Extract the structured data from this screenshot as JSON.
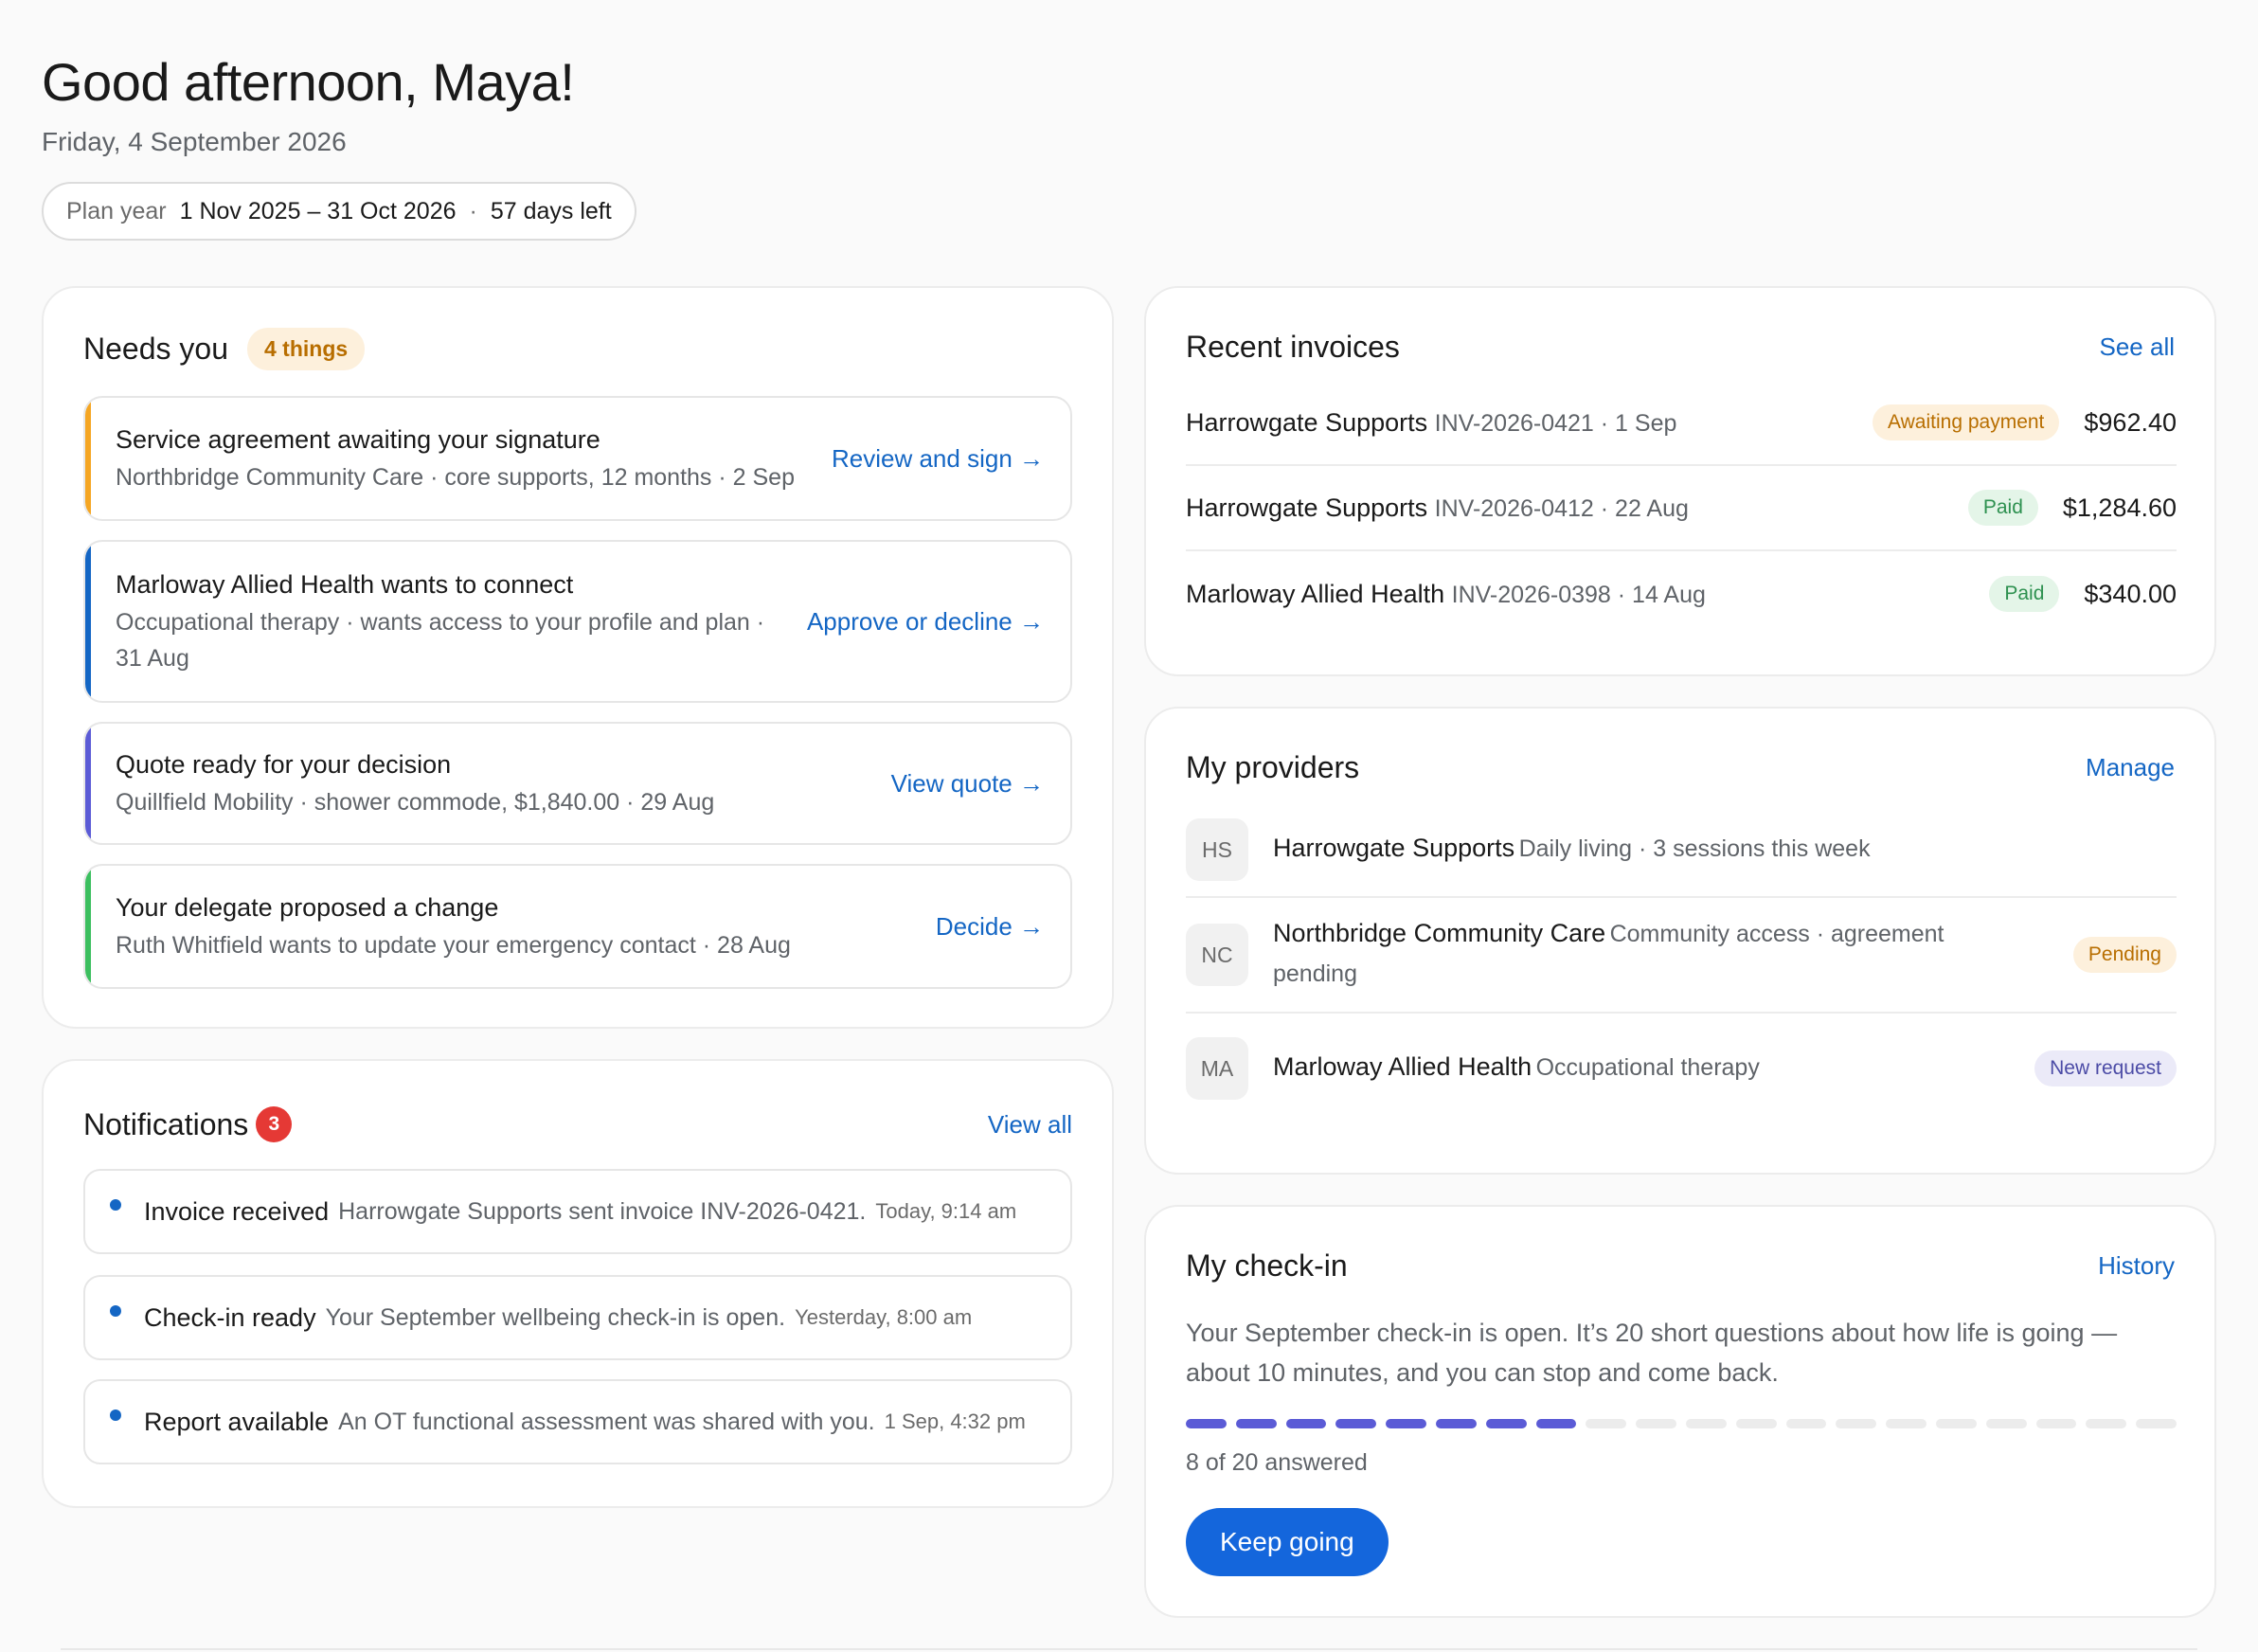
{
  "header": {
    "greeting": "Good afternoon, Maya!",
    "date": "Friday, 4 September 2026",
    "plan_label": "Plan year",
    "plan_range": "1 Nov 2025 – 31 Oct 2026",
    "plan_sep": "·",
    "days_left": "57 days left"
  },
  "needs_you": {
    "title": "Needs you",
    "badge": "4 things",
    "items": [
      {
        "title": "Service agreement awaiting your signature",
        "subtitle": "Northbridge Community Care · core supports, 12 months · 2 Sep",
        "action": "Review and sign →",
        "accent": "#f5a623"
      },
      {
        "title": "Marloway Allied Health wants to connect",
        "subtitle": "Occupational therapy · wants access to your profile and plan · 31 Aug",
        "action": "Approve or decline →",
        "accent": "#1466c4"
      },
      {
        "title": "Quote ready for your decision",
        "subtitle": "Quillfield Mobility · shower commode, $1,840.00 · 29 Aug",
        "action": "View quote →",
        "accent": "#5b5bd6"
      },
      {
        "title": "Your delegate proposed a change",
        "subtitle": "Ruth Whitfield wants to update your emergency contact · 28 Aug",
        "action": "Decide →",
        "accent": "#3cbf5f"
      }
    ]
  },
  "notifications": {
    "title": "Notifications",
    "count": "3",
    "view_all": "View all",
    "items": [
      {
        "title": "Invoice received",
        "desc": "Harrowgate Supports sent invoice INV-2026-0421.",
        "time": "Today, 9:14 am"
      },
      {
        "title": "Check-in ready",
        "desc": "Your September wellbeing check-in is open.",
        "time": "Yesterday, 8:00 am"
      },
      {
        "title": "Report available",
        "desc": "An OT functional assessment was shared with you.",
        "time": "1 Sep, 4:32 pm"
      }
    ]
  },
  "invoices": {
    "title": "Recent invoices",
    "see_all": "See all",
    "rows": [
      {
        "provider": "Harrowgate Supports",
        "meta": "INV-2026-0421 · 1 Sep",
        "status": "Awaiting payment",
        "amount": "$962.40"
      },
      {
        "provider": "Harrowgate Supports",
        "meta": "INV-2026-0412 · 22 Aug",
        "status": "Paid",
        "amount": "$1,284.60"
      },
      {
        "provider": "Marloway Allied Health",
        "meta": "INV-2026-0398 · 14 Aug",
        "status": "Paid",
        "amount": "$340.00"
      }
    ]
  },
  "providers": {
    "title": "My providers",
    "manage": "Manage",
    "rows": [
      {
        "initials": "HS",
        "name": "Harrowgate Supports",
        "desc": "Daily living · 3 sessions this week",
        "status": ""
      },
      {
        "initials": "NC",
        "name": "Northbridge Community Care",
        "desc": "Community access · agreement pending",
        "status": "Pending"
      },
      {
        "initials": "MA",
        "name": "Marloway Allied Health",
        "desc": "Occupational therapy",
        "status": "New request"
      }
    ]
  },
  "checkin": {
    "title": "My check-in",
    "history": "History",
    "body": "Your September check-in is open. It’s 20 short questions about how life is going — about 10 minutes, and you can stop and come back.",
    "answered": 8,
    "total": 20,
    "answered_label": "8 of 20 answered",
    "button": "Keep going"
  },
  "colors": {
    "link": "#1466c4",
    "primary_button": "#1466dc",
    "progress_fill": "#5b5bd6",
    "badge_red": "#e53935"
  }
}
